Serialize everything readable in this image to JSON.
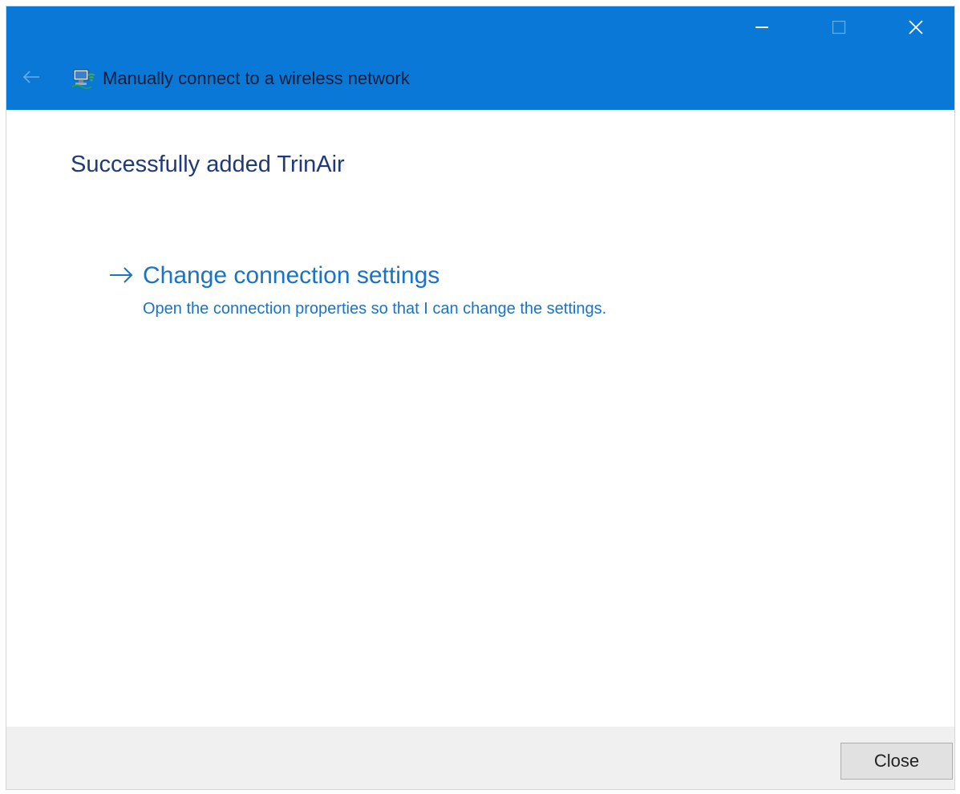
{
  "window": {
    "title": "Manually connect to a wireless network",
    "controls": {
      "minimize_icon": "minimize-icon",
      "maximize_icon": "maximize-icon",
      "close_icon": "close-icon"
    },
    "back_icon": "back-arrow-icon",
    "app_icon": "network-wizard-icon"
  },
  "content": {
    "heading": "Successfully added TrinAir",
    "command_link": {
      "icon": "arrow-right-icon",
      "title": "Change connection settings",
      "description": "Open the connection properties so that I can change the settings."
    }
  },
  "footer": {
    "close_label": "Close"
  },
  "colors": {
    "titlebar": "#0a78d7",
    "heading": "#1e3a78",
    "link": "#1a73c5",
    "footer": "#f0f0f0"
  }
}
